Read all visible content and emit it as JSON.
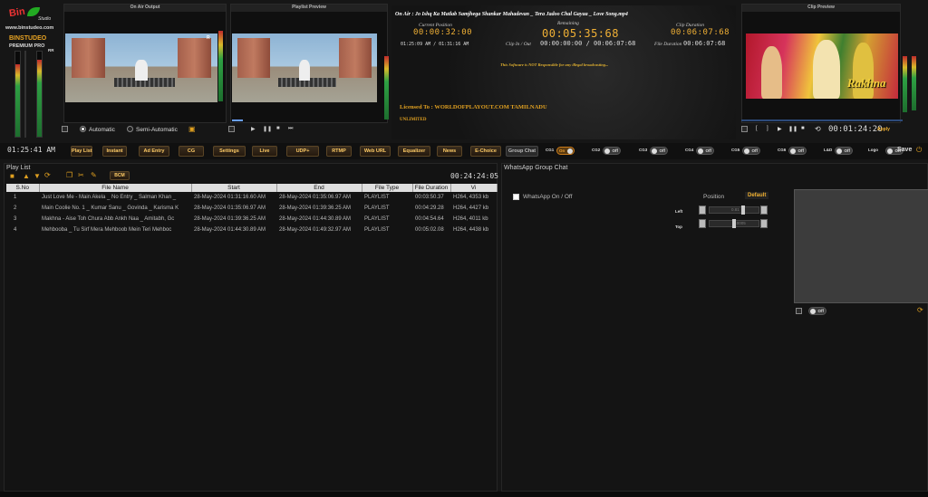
{
  "brand": {
    "logo_text": "Bin",
    "logo_sub": "Studio",
    "url": "www.binstudeo.com",
    "name": "BINSTUDEO",
    "version": "PREMIUM PRO"
  },
  "vu_levels": [
    0.85,
    0.9
  ],
  "on_air": {
    "title": "On Air Output",
    "side_label": "s",
    "side_label2": "R"
  },
  "preview": {
    "title": "Playlist Preview"
  },
  "clip": {
    "title": "Clip Preview",
    "overlay": "Rakhna",
    "timecode": "00:01:24:20",
    "apply": "Apply"
  },
  "mode": {
    "automatic": "Automatic",
    "semi": "Semi-Automatic"
  },
  "status": {
    "on_air_text": "On Air :  Jo Ishq Ka Matlab Samjhega  Shankar Mahadevan _ Tera Jadoo Chal Gayaa _ Love Song.mp4",
    "current_position_label": "Current Position",
    "current_position": "00:00:32:00",
    "remaining_label": "Remaining",
    "remaining": "00:05:35:68",
    "clip_duration_label": "Clip Duration",
    "clip_duration": "00:06:07:68",
    "range_time": "01:25:09 AM / 01:31:16 AM",
    "clip_inout_label": "Clip In / Out",
    "clip_inout": "00:00:00:00 / 00:06:07:68",
    "file_duration_label": "File Duration",
    "file_duration": "00:06:07:68",
    "disclaimer": "This Software is NOT Responsible for any illegal broadcasting...",
    "licensed": "Licensed To : WORLDOFPLAYOUT.COM TAMILNADU",
    "license_type": "UNLIMITED"
  },
  "clock": "01:25:41 AM",
  "toolbar": {
    "buttons": [
      "Play List",
      "Instant",
      "Ad Entry",
      "CG",
      "Settings",
      "Live",
      "UDP+",
      "RTMP",
      "Web URL",
      "Equalizer",
      "News",
      "E-Choice",
      "Group Chat"
    ],
    "toggles": [
      {
        "label": "CG1",
        "state": "On"
      },
      {
        "label": "CG2",
        "state": "Off"
      },
      {
        "label": "CG3",
        "state": "Off"
      },
      {
        "label": "CG4",
        "state": "Off"
      },
      {
        "label": "CG5",
        "state": "Off"
      },
      {
        "label": "CG6",
        "state": "Off"
      },
      {
        "label": "L&D",
        "state": "Off"
      },
      {
        "label": "Logo",
        "state": "Off"
      }
    ],
    "save": "Save"
  },
  "playlist": {
    "title": "Play List",
    "bcm": "BCM",
    "total": "00:24:24:05",
    "columns": [
      "S.No",
      "File Name",
      "Start",
      "End",
      "File Type",
      "File Duration",
      "Vi"
    ],
    "rows": [
      [
        "1",
        "Just Love Me - Main Akela _ No Entry _ Salman Khan _",
        "28-May-2024 01:31:16.60 AM",
        "28-May-2024 01:35:06.97 AM",
        "PLAYLIST",
        "00:03:50.37",
        "H264, 4353 kb"
      ],
      [
        "2",
        "Main Coolie No. 1 _ Kumar Sanu _ Govinda _ Karisma K",
        "28-May-2024 01:35:06.97 AM",
        "28-May-2024 01:39:36.25 AM",
        "PLAYLIST",
        "00:04:29.28",
        "H264, 4427 kb"
      ],
      [
        "3",
        "Makhna - Aise Toh Chura Abb Ankh Naa _ Amitabh, Gc",
        "28-May-2024 01:39:36.25 AM",
        "28-May-2024 01:44:30.89 AM",
        "PLAYLIST",
        "00:04:54.64",
        "H264, 4011 kb"
      ],
      [
        "4",
        "Mehbooba _ Tu Sirf Mera Mehboob Mein Teri Mehboc",
        "28-May-2024 01:44:30.89 AM",
        "28-May-2024 01:49:32.97 AM",
        "PLAYLIST",
        "00:05:02.08",
        "H264, 4438 kb"
      ]
    ]
  },
  "whatsapp": {
    "title": "WhatsApp Group Chat",
    "toggle_label": "WhatsApp On / Off",
    "position": "Position",
    "default": "Default",
    "left": "Left",
    "top": "Top",
    "left_val": "0.81",
    "top_val": "0.0005",
    "state": "Off"
  },
  "colors": {
    "accent": "#f0b035",
    "button_text": "#ffcc66"
  }
}
